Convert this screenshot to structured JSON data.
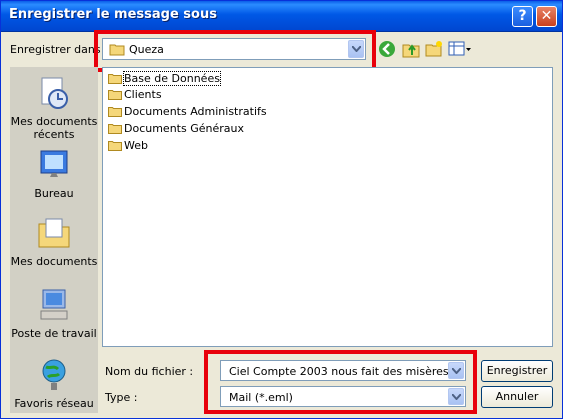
{
  "window": {
    "title": "Enregistrer le message sous"
  },
  "titlebar_buttons": {
    "help": "?",
    "close": "✕"
  },
  "save_in": {
    "label": "Enregistrer dans",
    "value": "Queza"
  },
  "places": [
    {
      "label": "Mes documents récents",
      "icon": "recent-documents-icon"
    },
    {
      "label": "Bureau",
      "icon": "desktop-icon"
    },
    {
      "label": "Mes documents",
      "icon": "my-documents-icon"
    },
    {
      "label": "Poste de travail",
      "icon": "my-computer-icon"
    },
    {
      "label": "Favoris réseau",
      "icon": "network-places-icon"
    }
  ],
  "files": [
    {
      "name": "Base de Données",
      "icon": "folder-icon"
    },
    {
      "name": "Clients",
      "icon": "folder-icon"
    },
    {
      "name": "Documents Administratifs",
      "icon": "folder-icon"
    },
    {
      "name": "Documents Généraux",
      "icon": "folder-icon"
    },
    {
      "name": "Web",
      "icon": "folder-icon"
    }
  ],
  "filename": {
    "label": "Nom du fichier :",
    "value": "Ciel Compte 2003 nous fait des misères"
  },
  "filetype": {
    "label": "Type :",
    "value": "Mail (*.eml)"
  },
  "buttons": {
    "save": "Enregistrer",
    "cancel": "Annuler"
  },
  "colors": {
    "titlebar": "#0058e6",
    "highlight": "#e8000b",
    "dialog": "#ece9d8"
  }
}
